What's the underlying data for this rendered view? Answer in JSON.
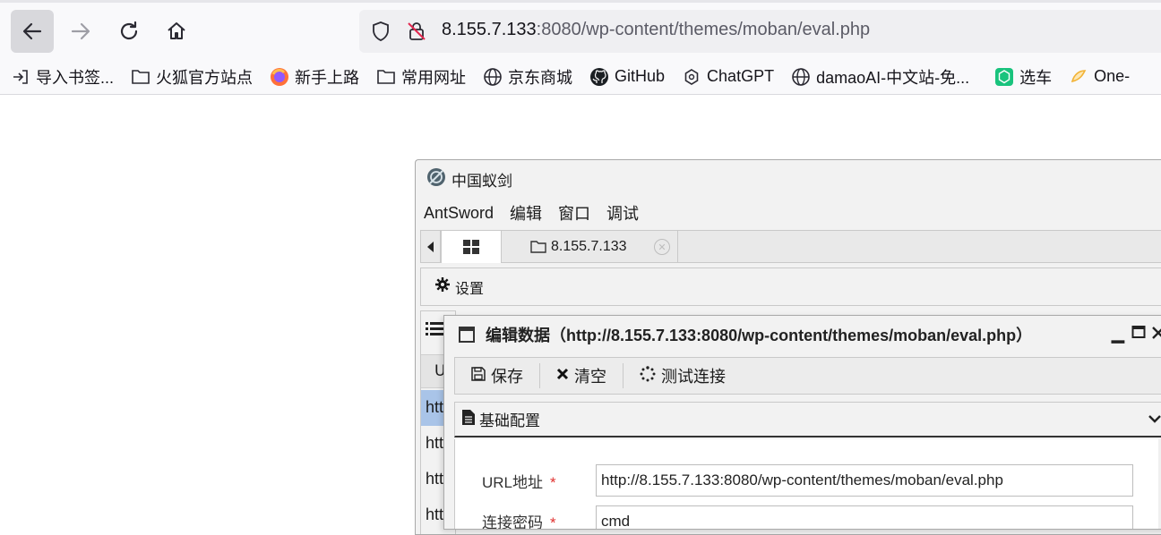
{
  "browser": {
    "url_host": "8.155.7.133",
    "url_path": ":8080/wp-content/themes/moban/eval.php",
    "bookmarks": [
      {
        "label": "导入书签...",
        "icon": "import-icon"
      },
      {
        "label": "火狐官方站点",
        "icon": "folder-icon"
      },
      {
        "label": "新手上路",
        "icon": "firefox-icon"
      },
      {
        "label": "常用网址",
        "icon": "folder-icon"
      },
      {
        "label": "京东商城",
        "icon": "globe-icon"
      },
      {
        "label": "GitHub",
        "icon": "github-icon"
      },
      {
        "label": "ChatGPT",
        "icon": "openai-icon"
      },
      {
        "label": "damaoAI-中文站-免...",
        "icon": "globe-icon"
      },
      {
        "label": "选车",
        "icon": "openai-green-icon"
      },
      {
        "label": "One-",
        "icon": "one-icon"
      }
    ]
  },
  "app": {
    "title": "中国蚁剑",
    "menu": [
      "AntSword",
      "编辑",
      "窗口",
      "调试"
    ],
    "tab_site_label": "8.155.7.133",
    "settings_label": "设置",
    "list_col_header": "U",
    "list_rows": [
      "htt",
      "htt",
      "htt",
      "htt"
    ]
  },
  "dialog": {
    "title": "编辑数据（http://8.155.7.133:8080/wp-content/themes/moban/eval.php）",
    "toolbar": {
      "save": "保存",
      "clear": "清空",
      "test": "测试连接"
    },
    "section_title": "基础配置",
    "fields": {
      "url_label": "URL地址",
      "url_value": "http://8.155.7.133:8080/wp-content/themes/moban/eval.php",
      "password_label": "连接密码",
      "password_value": "cmd"
    }
  },
  "colors": {
    "required": "#e0312f",
    "selected_row": "#a9c4e8"
  }
}
